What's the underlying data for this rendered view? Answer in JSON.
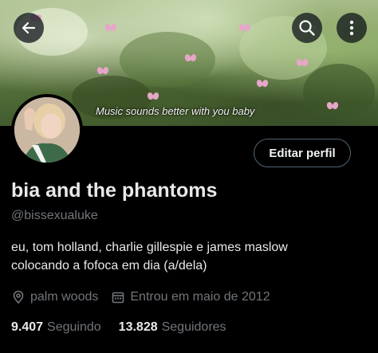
{
  "banner": {
    "caption": "Music sounds better with you baby"
  },
  "profile": {
    "display_name": "bia and the phantoms",
    "handle": "@bissexualuke",
    "bio_line1": "eu, tom holland, charlie gillespie e james maslow",
    "bio_line2": "colocando a fofoca em dia (a/dela)",
    "location": "palm woods",
    "joined": "Entrou em maio de 2012",
    "following_count": "9.407",
    "following_label": "Seguindo",
    "followers_count": "13.828",
    "followers_label": "Seguidores"
  },
  "actions": {
    "edit_profile": "Editar perfil"
  },
  "icons": {
    "back": "back-arrow-icon",
    "search": "search-icon",
    "more": "more-vertical-icon",
    "location": "location-pin-icon",
    "calendar": "calendar-icon"
  },
  "colors": {
    "background": "#000000",
    "text_primary": "#e7e9ea",
    "text_secondary": "#71767b",
    "button_border": "#536471"
  }
}
